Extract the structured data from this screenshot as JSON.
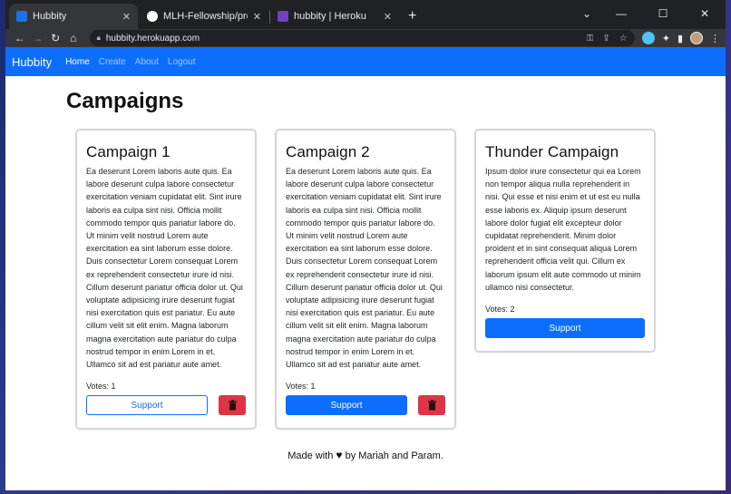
{
  "browser": {
    "tabs": [
      {
        "title": "Hubbity",
        "active": true,
        "favicon_color": "#1a73e8"
      },
      {
        "title": "MLH-Fellowship/project-hubbity",
        "active": false,
        "favicon_color": "#ffffff"
      },
      {
        "title": "hubbity | Heroku",
        "active": false,
        "favicon_color": "#6f42c1"
      }
    ],
    "new_tab": "+",
    "url": "hubbity.herokuapp.com"
  },
  "site": {
    "brand": "Hubbity",
    "nav": [
      "Home",
      "Create",
      "About",
      "Logout"
    ]
  },
  "page": {
    "title": "Campaigns"
  },
  "campaigns": [
    {
      "title": "Campaign 1",
      "description": "Ea deserunt Lorem laboris aute quis. Ea labore deserunt culpa labore consectetur exercitation veniam cupidatat elit. Sint irure laboris ea culpa sint nisi. Officia mollit commodo tempor quis pariatur labore do. Ut minim velit nostrud Lorem aute exercitation ea sint laborum esse dolore. Duis consectetur Lorem consequat Lorem ex reprehenderit consectetur irure id nisi. Cillum deserunt pariatur officia dolor ut. Qui voluptate adipisicing irure deserunt fugiat nisi exercitation quis est pariatur. Eu aute cillum velit sit elit enim. Magna laborum magna exercitation aute pariatur do culpa nostrud tempor in enim Lorem in et. Ullamco sit ad est pariatur aute amet.",
      "votes": "Votes: 1",
      "support_label": "Support"
    },
    {
      "title": "Campaign 2",
      "description": "Ea deserunt Lorem laboris aute quis. Ea labore deserunt culpa labore consectetur exercitation veniam cupidatat elit. Sint irure laboris ea culpa sint nisi. Officia mollit commodo tempor quis pariatur labore do. Ut minim velit nostrud Lorem aute exercitation ea sint laborum esse dolore. Duis consectetur Lorem consequat Lorem ex reprehenderit consectetur irure id nisi. Cillum deserunt pariatur officia dolor ut. Qui voluptate adipisicing irure deserunt fugiat nisi exercitation quis est pariatur. Eu aute cillum velit sit elit enim. Magna laborum magna exercitation aute pariatur do culpa nostrud tempor in enim Lorem in et. Ullamco sit ad est pariatur aute amet.",
      "votes": "Votes: 1",
      "support_label": "Support"
    },
    {
      "title": "Thunder Campaign",
      "description": "Ipsum dolor irure consectetur qui ea Lorem non tempor aliqua nulla reprehenderit in nisi. Qui esse et nisi enim et ut est eu nulla esse laboris ex. Aliquip ipsum deserunt labore dolor fugiat elit excepteur dolor cupidatat reprehenderit. Minim dolor proident et in sint consequat aliqua Lorem reprehenderit officia velit qui. Cillum ex laborum ipsum elit aute commodo ut minim ullamco nisi consectetur.",
      "votes": "Votes: 2",
      "support_label": "Support"
    }
  ],
  "footer": {
    "before": "Made with",
    "after": "by Mariah and Param."
  },
  "colors": {
    "primary": "#0d6efd",
    "danger": "#dc3545"
  }
}
